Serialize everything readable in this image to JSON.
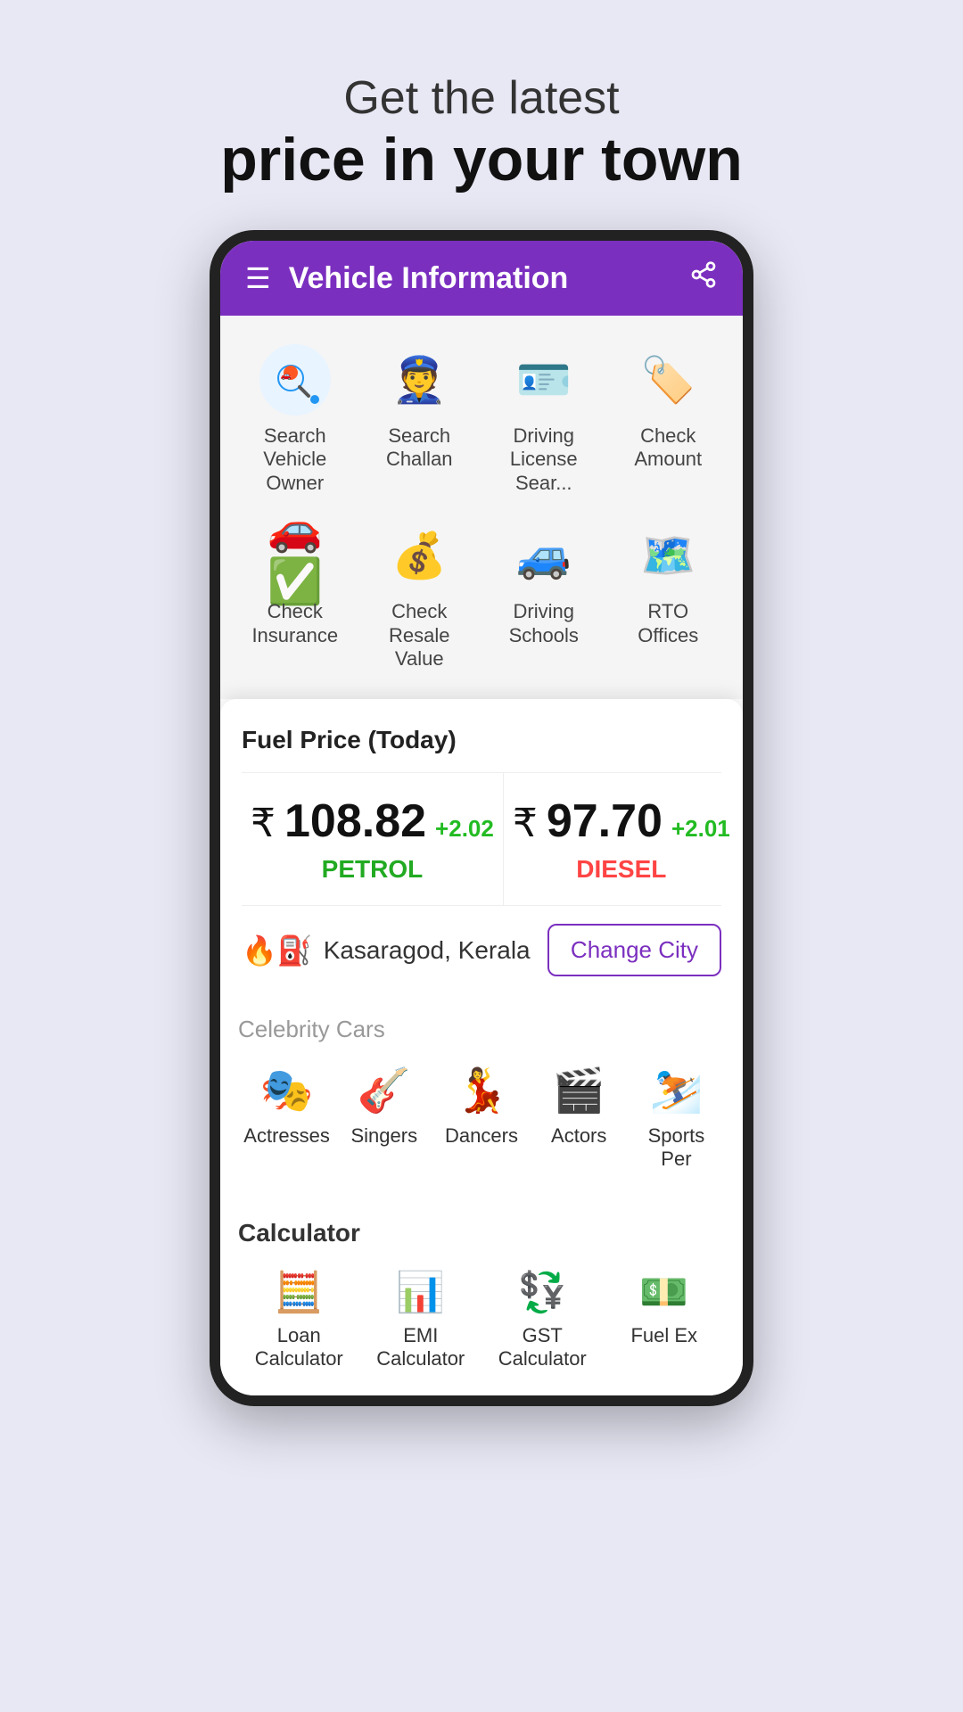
{
  "hero": {
    "subtitle": "Get the latest",
    "title": "price in your town"
  },
  "app": {
    "header": {
      "title": "Vehicle Information",
      "menu_icon": "☰",
      "share_icon": "⎋"
    },
    "grid_items": [
      {
        "id": "search-vehicle-owner",
        "label": "Search Vehicle Owner",
        "icon": "🔍",
        "icon_bg": "#e8f4ff"
      },
      {
        "id": "search-challan",
        "label": "Search Challan",
        "icon": "👮",
        "icon_bg": "#fff0e8"
      },
      {
        "id": "driving-license-search",
        "label": "Driving License Sear...",
        "icon": "🪪",
        "icon_bg": "#e8f0ff"
      },
      {
        "id": "check-amount",
        "label": "Check Amount",
        "icon": "🏷️",
        "icon_bg": "#ffe8e8"
      },
      {
        "id": "check-insurance",
        "label": "Check Insurance",
        "icon": "✅",
        "icon_bg": "#e8ffe8"
      },
      {
        "id": "check-resale-value",
        "label": "Check Resale Value",
        "icon": "💰",
        "icon_bg": "#fffbe8"
      },
      {
        "id": "driving-schools",
        "label": "Driving Schools",
        "icon": "🚗",
        "icon_bg": "#e8f8ff"
      },
      {
        "id": "rto-offices",
        "label": "RTO Offices",
        "icon": "🗺️",
        "icon_bg": "#fff0f8"
      }
    ],
    "fuel_card": {
      "title": "Fuel Price (Today)",
      "petrol": {
        "price": "108.82",
        "change": "+2.02",
        "label": "PETROL"
      },
      "diesel": {
        "price": "97.70",
        "change": "+2.01",
        "label": "DIESEL"
      },
      "city": "Kasaragod, Kerala",
      "change_city_btn": "Change City"
    },
    "celebrity_section": {
      "title": "Celebrity Cars",
      "items": [
        {
          "id": "actresses",
          "label": "Actresses",
          "icon": "🎭"
        },
        {
          "id": "singers",
          "label": "Singers",
          "icon": "🎸"
        },
        {
          "id": "dancers",
          "label": "Dancers",
          "icon": "💃"
        },
        {
          "id": "actors",
          "label": "Actors",
          "icon": "🎬"
        },
        {
          "id": "sports-persons",
          "label": "Sports Per",
          "icon": "⛷️"
        }
      ]
    },
    "calculator_section": {
      "title": "Calculator",
      "items": [
        {
          "id": "loan-calculator",
          "label": "Loan Calculator",
          "icon": "🧮"
        },
        {
          "id": "emi-calculator",
          "label": "EMI Calculator",
          "icon": "📊"
        },
        {
          "id": "gst-calculator",
          "label": "GST Calculator",
          "icon": "💱"
        },
        {
          "id": "fuel-ex",
          "label": "Fuel Ex",
          "icon": "💵"
        }
      ]
    }
  }
}
